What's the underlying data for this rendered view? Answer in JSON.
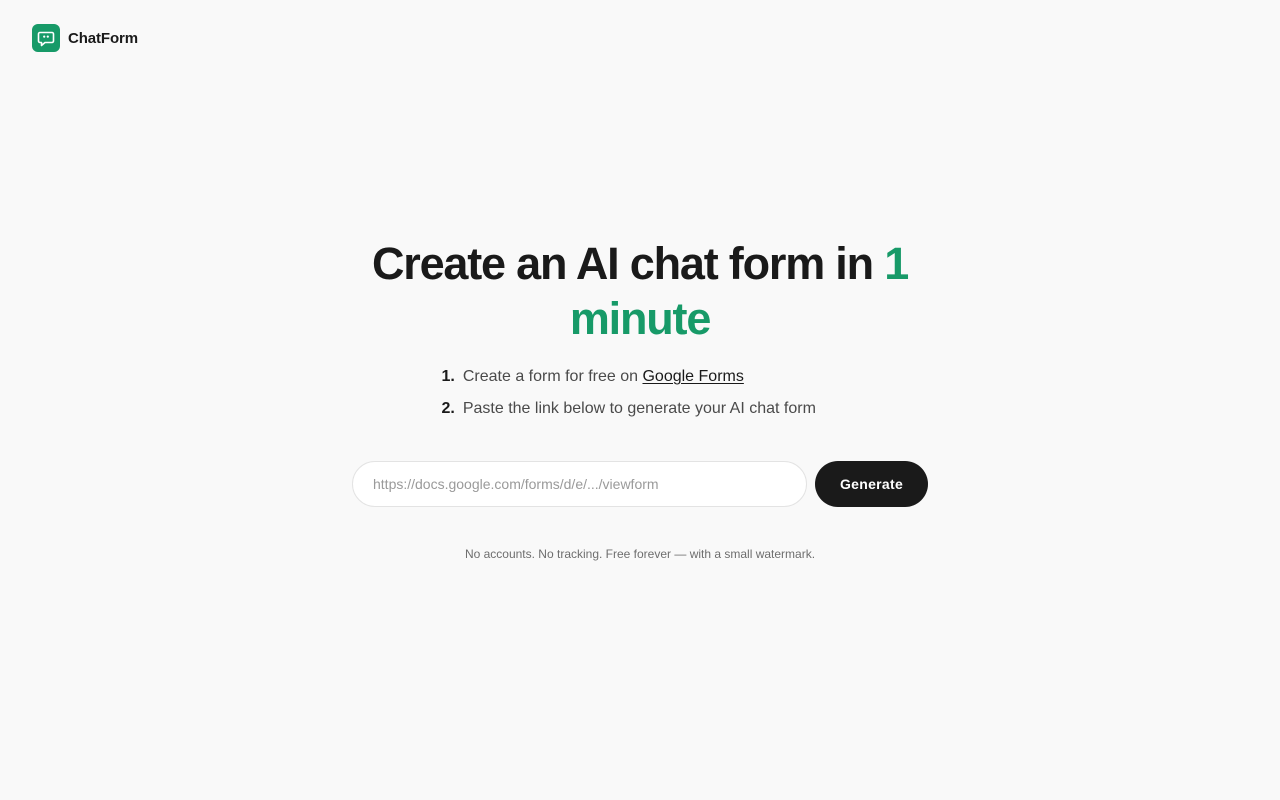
{
  "brand": {
    "name": "ChatForm",
    "logo_icon": "chat-bubble-quote-icon",
    "accent_color": "#179a68"
  },
  "hero": {
    "headline_main": "Create an AI chat form in ",
    "headline_accent": "1 minute"
  },
  "steps": [
    {
      "number": "1.",
      "text": "Create a form for free on ",
      "link_text": "Google Forms"
    },
    {
      "number": "2.",
      "text": "Paste the link below to generate your AI chat form"
    }
  ],
  "form": {
    "url_value": "",
    "url_placeholder": "https://docs.google.com/forms/d/e/.../viewform",
    "generate_label": "Generate"
  },
  "footnote": "No accounts. No tracking. Free forever — with a small watermark."
}
